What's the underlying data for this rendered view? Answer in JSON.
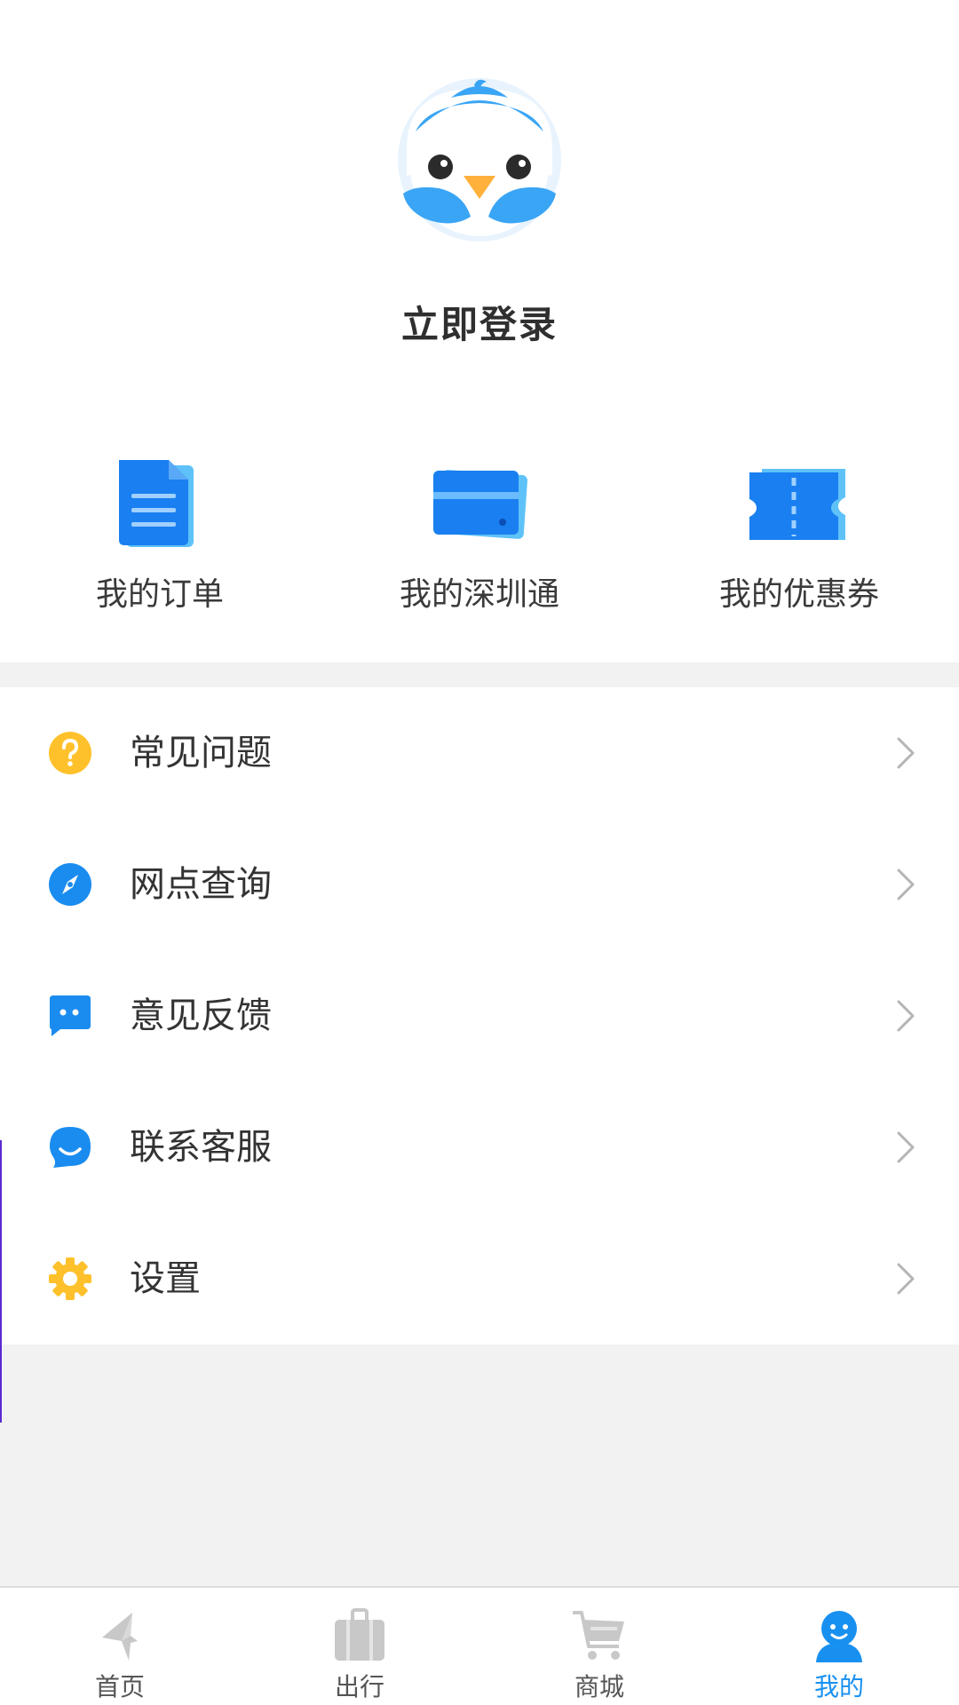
{
  "profile": {
    "login_label": "立即登录"
  },
  "quick_entries": [
    {
      "label": "我的订单",
      "icon": "order-document-icon"
    },
    {
      "label": "我的深圳通",
      "icon": "transit-card-icon"
    },
    {
      "label": "我的优惠券",
      "icon": "coupon-ticket-icon"
    }
  ],
  "menu": [
    {
      "label": "常见问题",
      "icon": "question-icon",
      "color": "#ffc12b"
    },
    {
      "label": "网点查询",
      "icon": "compass-icon",
      "color": "#1a8cf0"
    },
    {
      "label": "意见反馈",
      "icon": "feedback-message-icon",
      "color": "#1a8cf0"
    },
    {
      "label": "联系客服",
      "icon": "customer-service-icon",
      "color": "#1a8cf0"
    },
    {
      "label": "设置",
      "icon": "gear-icon",
      "color": "#ffc12b"
    }
  ],
  "tabbar": {
    "tabs": [
      {
        "label": "首页",
        "icon": "home-plane-icon",
        "active": false
      },
      {
        "label": "出行",
        "icon": "luggage-icon",
        "active": false
      },
      {
        "label": "商城",
        "icon": "shopping-cart-icon",
        "active": false
      },
      {
        "label": "我的",
        "icon": "profile-icon",
        "active": true
      }
    ],
    "active_color": "#1890f0",
    "inactive_color": "#c8c8c8"
  },
  "colors": {
    "brand_blue": "#1a8cf0",
    "accent_yellow": "#ffc12b",
    "background_gray": "#f2f2f2"
  }
}
